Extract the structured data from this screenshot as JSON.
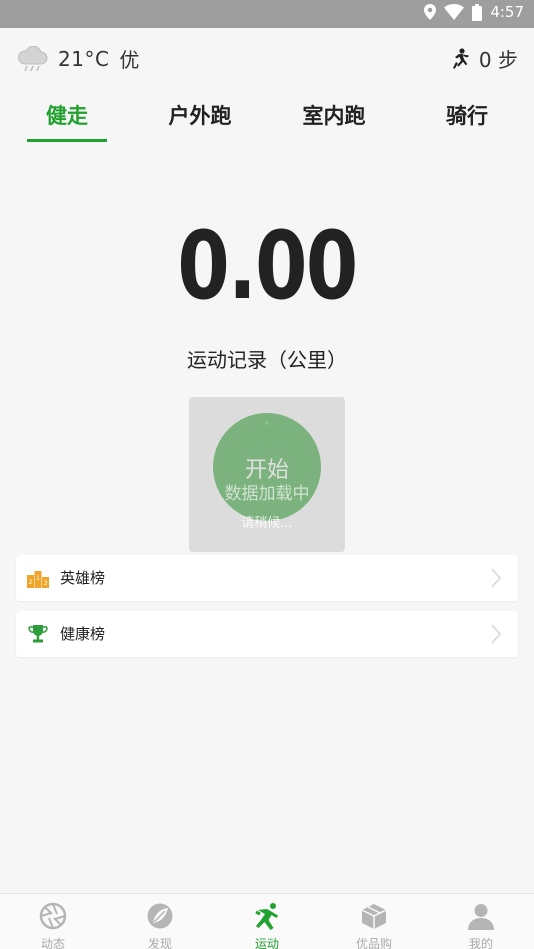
{
  "status_bar": {
    "time": "4:57",
    "icons": [
      "location-icon",
      "wifi-icon",
      "battery-icon"
    ]
  },
  "weather": {
    "icon": "cloud-rain-icon",
    "temperature": "21°C",
    "air_quality": "优"
  },
  "steps": {
    "icon": "runner-icon",
    "value": "0 步"
  },
  "tabs": [
    {
      "label": "健走",
      "active": true
    },
    {
      "label": "户外跑",
      "active": false
    },
    {
      "label": "室内跑",
      "active": false
    },
    {
      "label": "骑行",
      "active": false
    }
  ],
  "distance": {
    "value": "0.00",
    "label": "运动记录（公里）"
  },
  "start": {
    "label": "开始",
    "loading": "数据加载中",
    "wait": "请稍候..."
  },
  "rankings": [
    {
      "label": "英雄榜",
      "icon": "podium-icon"
    },
    {
      "label": "健康榜",
      "icon": "trophy-icon"
    }
  ],
  "bottom_nav": [
    {
      "label": "动态",
      "icon": "aperture-icon",
      "active": false
    },
    {
      "label": "发现",
      "icon": "compass-leaf-icon",
      "active": false
    },
    {
      "label": "运动",
      "icon": "sport-icon",
      "active": true
    },
    {
      "label": "优品购",
      "icon": "box-icon",
      "active": false
    },
    {
      "label": "我的",
      "icon": "user-icon",
      "active": false
    }
  ],
  "colors": {
    "accent": "#21a12e",
    "start_button": "#1f9a25",
    "status_bar": "#9e9e9e"
  }
}
